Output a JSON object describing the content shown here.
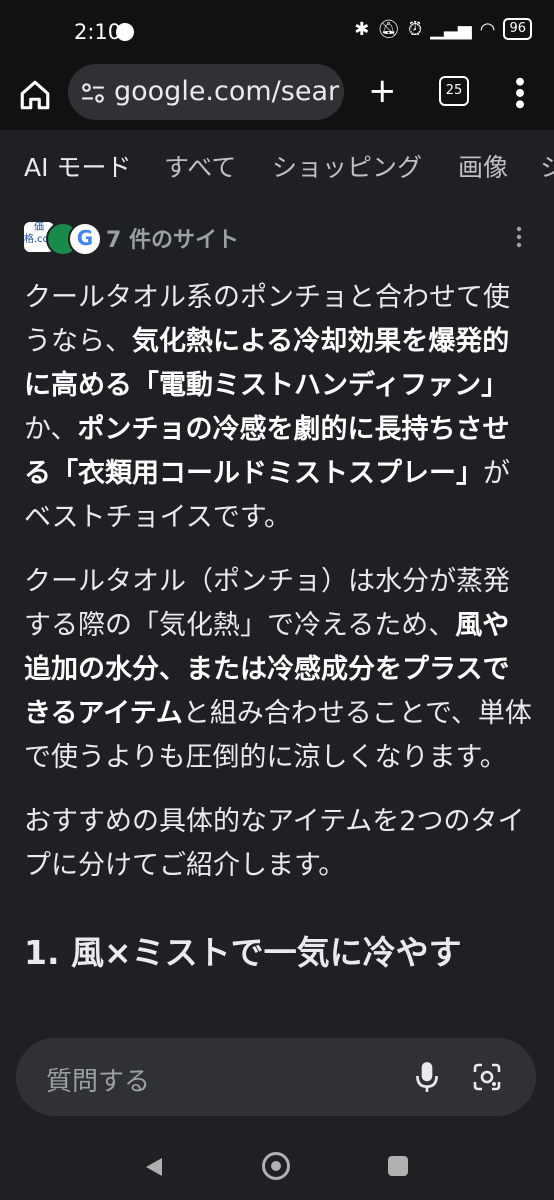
{
  "status": {
    "time": "2:10",
    "battery": "96"
  },
  "browser": {
    "url": "google.com/sear",
    "tab_count": "25"
  },
  "filters": [
    {
      "label": "AI モード"
    },
    {
      "label": "すべて"
    },
    {
      "label": "ショッピング"
    },
    {
      "label": "画像"
    },
    {
      "label": "シ"
    }
  ],
  "sources": {
    "label": "7 件のサイト",
    "kakaku_logo": "価格.com",
    "google_logo": "G"
  },
  "content": {
    "p1": [
      {
        "text": "クールタオル系のポンチョと合わせて使うなら、",
        "bold": false
      },
      {
        "text": "気化熱による冷却効果を爆発的に高める「電動ミストハンディファン」",
        "bold": true
      },
      {
        "text": "か、",
        "bold": false
      },
      {
        "text": "ポンチョの冷感を劇的に長持ちさせる「衣類用コールドミストスプレー」",
        "bold": true
      },
      {
        "text": "がベストチョイスです。",
        "bold": false
      }
    ],
    "p2": [
      {
        "text": "クールタオル（ポンチョ）は水分が蒸発する際の「気化熱」で冷えるため、",
        "bold": false
      },
      {
        "text": "風や追加の水分、または冷感成分をプラスできるアイテム",
        "bold": true
      },
      {
        "text": "と組み合わせることで、単体で使うよりも圧倒的に涼しくなります。",
        "bold": false
      }
    ],
    "p3": [
      {
        "text": "おすすめの具体的なアイテムを2つのタイプに分けてご紹介します。",
        "bold": false
      }
    ],
    "heading": "1. 風×ミストで一気に冷やす"
  },
  "ask": {
    "placeholder": "質問する"
  },
  "colors": {
    "background": "#1f2023",
    "chrome": "#111111",
    "pill": "#303134",
    "text": "#e8eaed",
    "muted": "#9aa0a6"
  }
}
